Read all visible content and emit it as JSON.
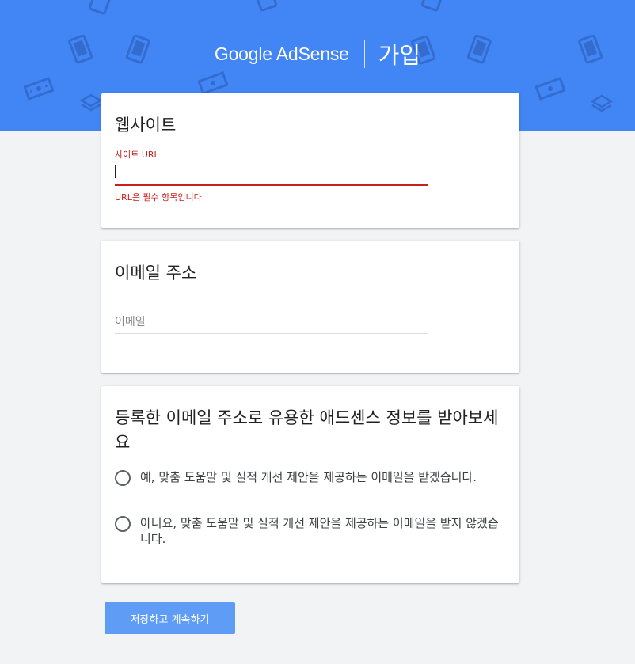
{
  "header": {
    "logo_text": "Google AdSense",
    "subtitle": "가입",
    "background_color": "#4285f4"
  },
  "website_section": {
    "title": "웹사이트",
    "url_label": "사이트 URL",
    "url_value": "",
    "url_error": "URL은 필수 항목입니다.",
    "error_color": "#c5221f"
  },
  "email_section": {
    "title": "이메일 주소",
    "email_placeholder": "이메일",
    "email_value": ""
  },
  "newsletter_section": {
    "title": "등록한 이메일 주소로 유용한 애드센스 정보를 받아보세요",
    "options": [
      {
        "label": "예, 맞춤 도움말 및 실적 개선 제안을 제공하는 이메일을 받겠습니다.",
        "selected": false
      },
      {
        "label": "아니요, 맞춤 도움말 및 실적 개선 제안을 제공하는 이메일을 받지 않겠습니다.",
        "selected": false
      }
    ]
  },
  "footer": {
    "submit_label": "저장하고 계속하기",
    "submit_color": "#5e9cf5"
  }
}
